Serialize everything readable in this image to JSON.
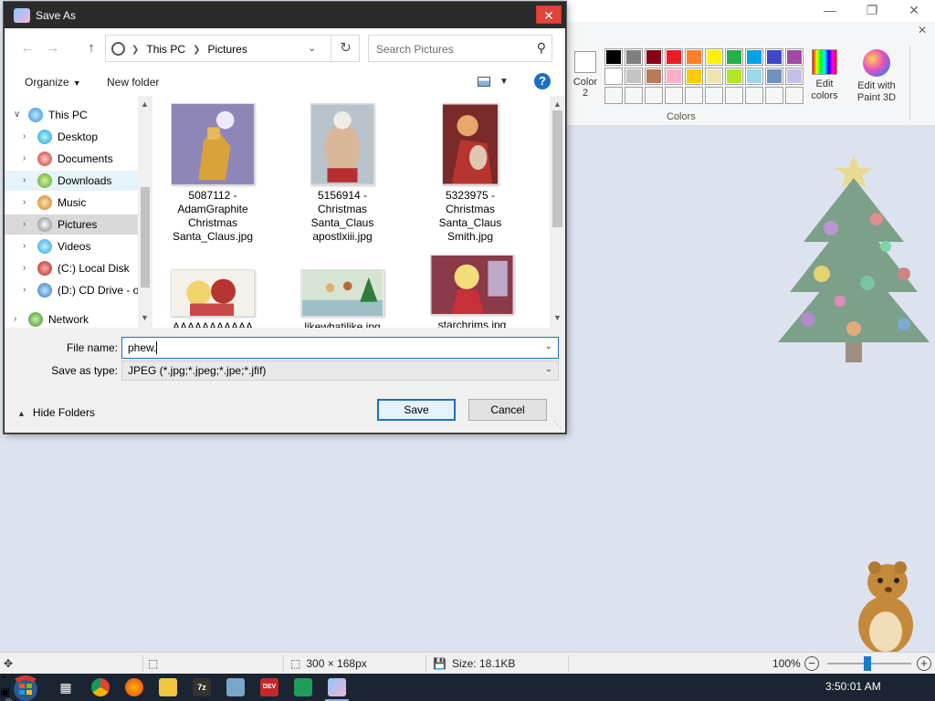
{
  "dialog": {
    "title": "Save As",
    "nav": {
      "breadcrumbs": [
        "This PC",
        "Pictures"
      ],
      "search_placeholder": "Search Pictures"
    },
    "toolbar": {
      "organize": "Organize",
      "new_folder": "New folder",
      "help": "?"
    },
    "nav_pane": [
      {
        "label": "This PC",
        "level": 0,
        "icon": "pc-icon"
      },
      {
        "label": "Desktop",
        "level": 1,
        "icon": "desktop-icon"
      },
      {
        "label": "Documents",
        "level": 1,
        "icon": "documents-icon"
      },
      {
        "label": "Downloads",
        "level": 1,
        "icon": "downloads-icon"
      },
      {
        "label": "Music",
        "level": 1,
        "icon": "music-icon"
      },
      {
        "label": "Pictures",
        "level": 1,
        "icon": "pictures-icon"
      },
      {
        "label": "Videos",
        "level": 1,
        "icon": "videos-icon"
      },
      {
        "label": "(C:) Local Disk",
        "level": 1,
        "icon": "disk-icon"
      },
      {
        "label": "(D:) CD Drive - o",
        "level": 1,
        "icon": "cd-drive-icon"
      },
      {
        "label": "Network",
        "level": 0,
        "icon": "network-icon"
      }
    ],
    "files": [
      {
        "name_lines": [
          "5087112 -",
          "AdamGraphite",
          "Christmas",
          "Santa_Claus.jpg"
        ]
      },
      {
        "name_lines": [
          "5156914 -",
          "Christmas",
          "Santa_Claus",
          "apostlxiii.jpg"
        ]
      },
      {
        "name_lines": [
          "5323975 -",
          "Christmas",
          "Santa_Claus",
          "Smith.jpg"
        ]
      },
      {
        "name_lines": [
          "AAAAAAAAAAA"
        ]
      },
      {
        "name_lines": [
          "likewhatilike.jpg"
        ]
      },
      {
        "name_lines": [
          "starchrims.jpg"
        ]
      }
    ],
    "form": {
      "file_name_label": "File name:",
      "file_name_value": "phew.",
      "save_as_type_label": "Save as type:",
      "save_as_type_value": "JPEG (*.jpg;*.jpeg;*.jpe;*.jfif)",
      "hide_folders": "Hide Folders",
      "save": "Save",
      "cancel": "Cancel"
    }
  },
  "paint": {
    "color2_label_1": "Color",
    "color2_label_2": "2",
    "palette_row1": [
      "#000000",
      "#7f7f7f",
      "#880015",
      "#ed1c24",
      "#ff7f27",
      "#fff200",
      "#22b14c",
      "#00a2e8",
      "#3f48cc",
      "#a349a4"
    ],
    "palette_row2": [
      "#ffffff",
      "#c3c3c3",
      "#b97a57",
      "#ffaec9",
      "#ffc90e",
      "#efe4b0",
      "#b5e61d",
      "#99d9ea",
      "#7092be",
      "#c8bfe7"
    ],
    "edit_colors_1": "Edit",
    "edit_colors_2": "colors",
    "paint3d_1": "Edit with",
    "paint3d_2": "Paint 3D",
    "group_label": "Colors"
  },
  "statusbar": {
    "dimensions": "300 × 168px",
    "size": "Size: 18.1KB",
    "zoom": "100%",
    "zoom_level": 1.0
  },
  "taskbar": {
    "clock": "3:50:01 AM"
  }
}
